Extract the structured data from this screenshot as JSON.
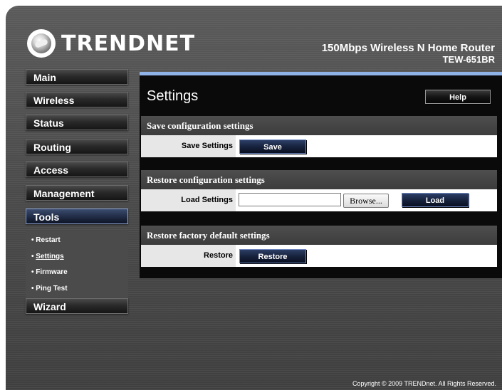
{
  "header": {
    "brand": "TRENDNET",
    "product_name": "150Mbps Wireless N Home Router",
    "model": "TEW-651BR"
  },
  "sidebar": {
    "items": [
      {
        "label": "Main"
      },
      {
        "label": "Wireless"
      },
      {
        "label": "Status"
      },
      {
        "label": "Routing"
      },
      {
        "label": "Access"
      },
      {
        "label": "Management"
      },
      {
        "label": "Tools"
      },
      {
        "label": "Wizard"
      }
    ],
    "tools_submenu": [
      {
        "label": "Restart"
      },
      {
        "label": "Settings"
      },
      {
        "label": "Firmware"
      },
      {
        "label": "Ping Test"
      }
    ]
  },
  "main": {
    "title": "Settings",
    "help_label": "Help",
    "sections": [
      {
        "heading": "Save configuration settings",
        "row_label": "Save Settings",
        "button": "Save"
      },
      {
        "heading": "Restore configuration settings",
        "row_label": "Load Settings",
        "file_value": "",
        "browse_label": "Browse...",
        "button": "Load"
      },
      {
        "heading": "Restore factory default settings",
        "row_label": "Restore",
        "button": "Restore"
      }
    ]
  },
  "footer": {
    "copyright": "Copyright © 2009 TRENDnet. All Rights Reserved."
  }
}
